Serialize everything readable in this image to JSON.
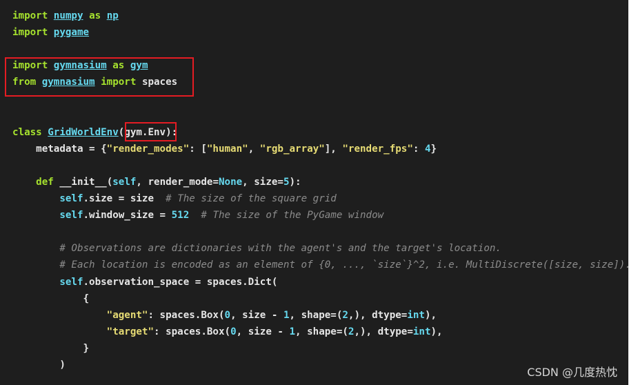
{
  "code": {
    "imports": {
      "l1_kw": "import",
      "l1_mod": "numpy",
      "l1_as": "as",
      "l1_alias": "np",
      "l2_kw": "import",
      "l2_mod": "pygame",
      "l4_kw": "import",
      "l4_mod": "gymnasium",
      "l4_as": "as",
      "l4_alias": "gym",
      "l5_from": "from",
      "l5_mod": "gymnasium",
      "l5_import": "import",
      "l5_name": "spaces"
    },
    "class_def": {
      "kw": "class",
      "name": "GridWorldEnv",
      "open": "(",
      "base": "gym.Env",
      "close": "):"
    },
    "metadata": {
      "lead": "    metadata = {",
      "k1": "\"render_modes\"",
      "sep1": ": [",
      "v1": "\"human\"",
      "comma": ", ",
      "v2": "\"rgb_array\"",
      "sep2": "], ",
      "k2": "\"render_fps\"",
      "sep3": ": ",
      "v3": "4",
      "close": "}"
    },
    "init_def": {
      "indent": "    ",
      "kw": "def",
      "sp": " ",
      "name": "__init__",
      "open": "(",
      "self": "self",
      "rest1": ", render_mode=",
      "none": "None",
      "rest2": ", size=",
      "num": "5",
      "close": "):"
    },
    "size_line": {
      "indent": "        ",
      "self": "self",
      "rest": ".size = size  ",
      "comment": "# The size of the square grid"
    },
    "window_line": {
      "indent": "        ",
      "self": "self",
      "rest": ".window_size = ",
      "num": "512",
      "sp": "  ",
      "comment": "# The size of the PyGame window"
    },
    "comment1": "        # Observations are dictionaries with the agent's and the target's location.",
    "comment2": "        # Each location is encoded as an element of {0, ..., `size`}^2, i.e. MultiDiscrete([size, size]).",
    "obs_line": {
      "indent": "        ",
      "self": "self",
      "rest": ".observation_space = spaces.Dict("
    },
    "brace_open": "            {",
    "agent_line": {
      "indent": "                ",
      "key": "\"agent\"",
      "p1": ": spaces.Box(",
      "n0": "0",
      "p2": ", size - ",
      "n1": "1",
      "p3": ", shape=(",
      "n2": "2",
      "p4": ",), dtype=",
      "type": "int",
      "p5": "),"
    },
    "target_line": {
      "indent": "                ",
      "key": "\"target\"",
      "p1": ": spaces.Box(",
      "n0": "0",
      "p2": ", size - ",
      "n1": "1",
      "p3": ", shape=(",
      "n2": "2",
      "p4": ",), dtype=",
      "type": "int",
      "p5": "),"
    },
    "brace_close": "            }",
    "paren_close": "        )"
  },
  "watermark": "CSDN @几度热忱",
  "colors": {
    "background": "#1e1e1e",
    "keyword": "#a6e22e",
    "string": "#e6db74",
    "builtin": "#66d9ef",
    "comment": "#8c8c8c",
    "highlight_box": "#e51c23"
  }
}
